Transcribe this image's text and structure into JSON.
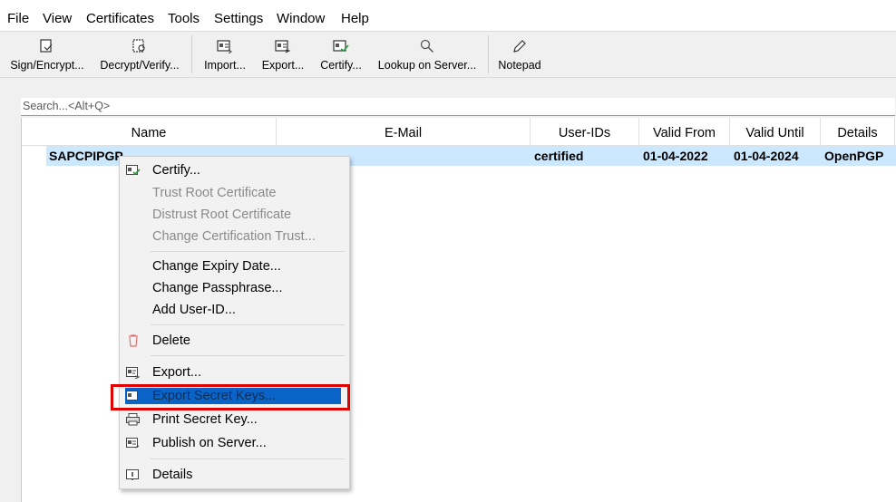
{
  "menubar": [
    "File",
    "View",
    "Certificates",
    "Tools",
    "Settings",
    "Window",
    "Help"
  ],
  "toolbar": {
    "sign_encrypt": "Sign/Encrypt...",
    "decrypt_verify": "Decrypt/Verify...",
    "import": "Import...",
    "export": "Export...",
    "certify": "Certify...",
    "lookup": "Lookup on Server...",
    "notepad": "Notepad"
  },
  "search": {
    "placeholder": "Search...<Alt+Q>"
  },
  "table": {
    "columns": [
      "Name",
      "E-Mail",
      "User-IDs",
      "Valid From",
      "Valid Until",
      "Details"
    ],
    "rows": [
      {
        "name": "SAPCPIPGP",
        "email": "",
        "user_ids": "certified",
        "valid_from": "01-04-2022",
        "valid_until": "01-04-2024",
        "details": "OpenPGP"
      }
    ]
  },
  "context_menu": {
    "certify": "Certify...",
    "trust_root": "Trust Root Certificate",
    "distrust_root": "Distrust Root Certificate",
    "change_cert_trust": "Change Certification Trust...",
    "change_expiry": "Change Expiry Date...",
    "change_passphrase": "Change Passphrase...",
    "add_user_id": "Add User-ID...",
    "delete": "Delete",
    "export": "Export...",
    "export_secret": "Export Secret Keys...",
    "print_secret": "Print Secret Key...",
    "publish": "Publish on Server...",
    "details": "Details"
  },
  "colors": {
    "selection": "#cce8ff",
    "highlight": "#0a64c8",
    "annotation": "#e00000"
  }
}
